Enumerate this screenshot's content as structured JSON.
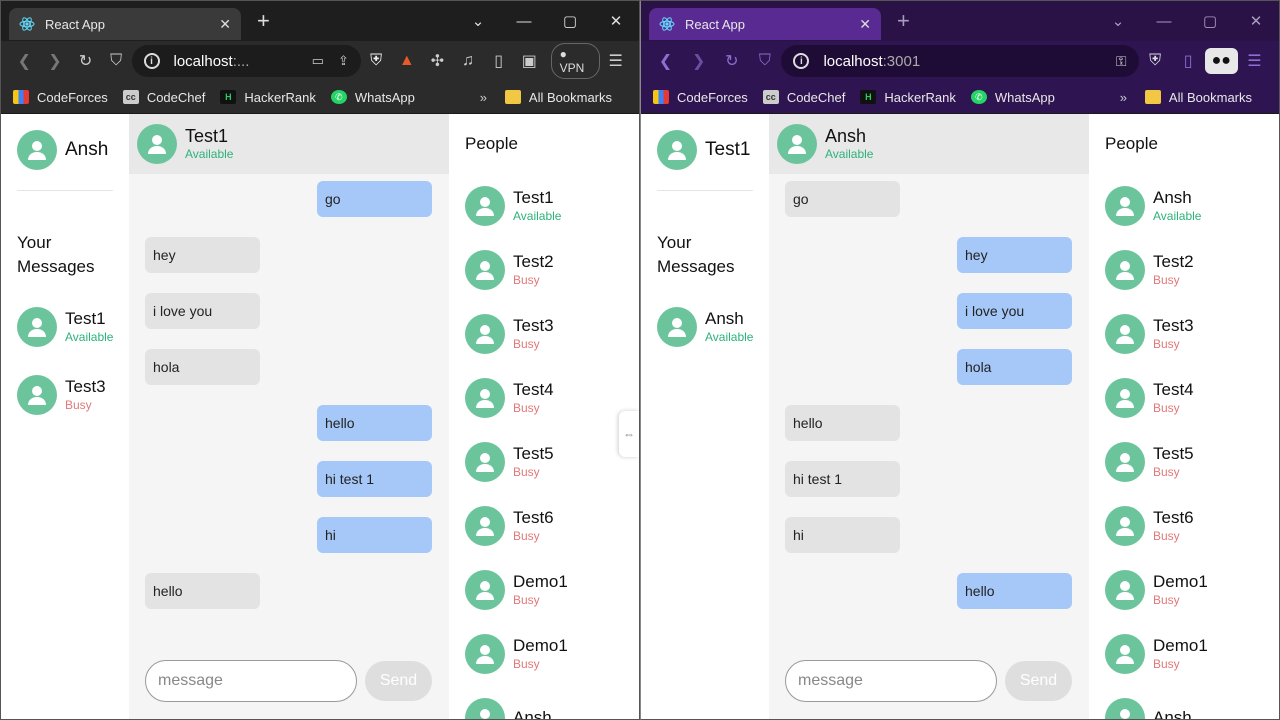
{
  "colors": {
    "avatar": "#6cc49c",
    "available": "#2db37a",
    "busy": "#e07a7a",
    "outgoing": "#a6c8f8",
    "incoming": "#e3e3e3"
  },
  "left_window": {
    "tab_title": "React App",
    "url_host": "localhost",
    "url_port": ":...",
    "vpn_label": "VPN",
    "bookmarks": [
      "CodeForces",
      "CodeChef",
      "HackerRank",
      "WhatsApp"
    ],
    "all_bookmarks": "All Bookmarks",
    "me": "Ansh",
    "your_messages_1": "Your",
    "your_messages_2": "Messages",
    "conversations": [
      {
        "name": "Test1",
        "status": "Available"
      },
      {
        "name": "Test3",
        "status": "Busy"
      }
    ],
    "chat_name": "Test1",
    "chat_status": "Available",
    "messages": [
      "go",
      "hey",
      "i love you",
      "hola",
      "hello",
      "hi test 1",
      "hi",
      "hello"
    ],
    "input_placeholder": "message",
    "send_label": "Send",
    "people_title": "People",
    "people": [
      {
        "name": "Test1",
        "status": "Available"
      },
      {
        "name": "Test2",
        "status": "Busy"
      },
      {
        "name": "Test3",
        "status": "Busy"
      },
      {
        "name": "Test4",
        "status": "Busy"
      },
      {
        "name": "Test5",
        "status": "Busy"
      },
      {
        "name": "Test6",
        "status": "Busy"
      },
      {
        "name": "Demo1",
        "status": "Busy"
      },
      {
        "name": "Demo1",
        "status": "Busy"
      },
      {
        "name": "Ansh",
        "status": ""
      }
    ]
  },
  "right_window": {
    "tab_title": "React App",
    "url_host": "localhost",
    "url_port": ":3001",
    "bookmarks": [
      "CodeForces",
      "CodeChef",
      "HackerRank",
      "WhatsApp"
    ],
    "all_bookmarks": "All Bookmarks",
    "me": "Test1",
    "your_messages_1": "Your",
    "your_messages_2": "Messages",
    "conversations": [
      {
        "name": "Ansh",
        "status": "Available"
      }
    ],
    "chat_name": "Ansh",
    "chat_status": "Available",
    "messages": [
      "go",
      "hey",
      "i love you",
      "hola",
      "hello",
      "hi test 1",
      "hi",
      "hello"
    ],
    "input_placeholder": "message",
    "send_label": "Send",
    "people_title": "People",
    "people": [
      {
        "name": "Ansh",
        "status": "Available"
      },
      {
        "name": "Test2",
        "status": "Busy"
      },
      {
        "name": "Test3",
        "status": "Busy"
      },
      {
        "name": "Test4",
        "status": "Busy"
      },
      {
        "name": "Test5",
        "status": "Busy"
      },
      {
        "name": "Test6",
        "status": "Busy"
      },
      {
        "name": "Demo1",
        "status": "Busy"
      },
      {
        "name": "Demo1",
        "status": "Busy"
      },
      {
        "name": "Ansh",
        "status": ""
      }
    ]
  }
}
